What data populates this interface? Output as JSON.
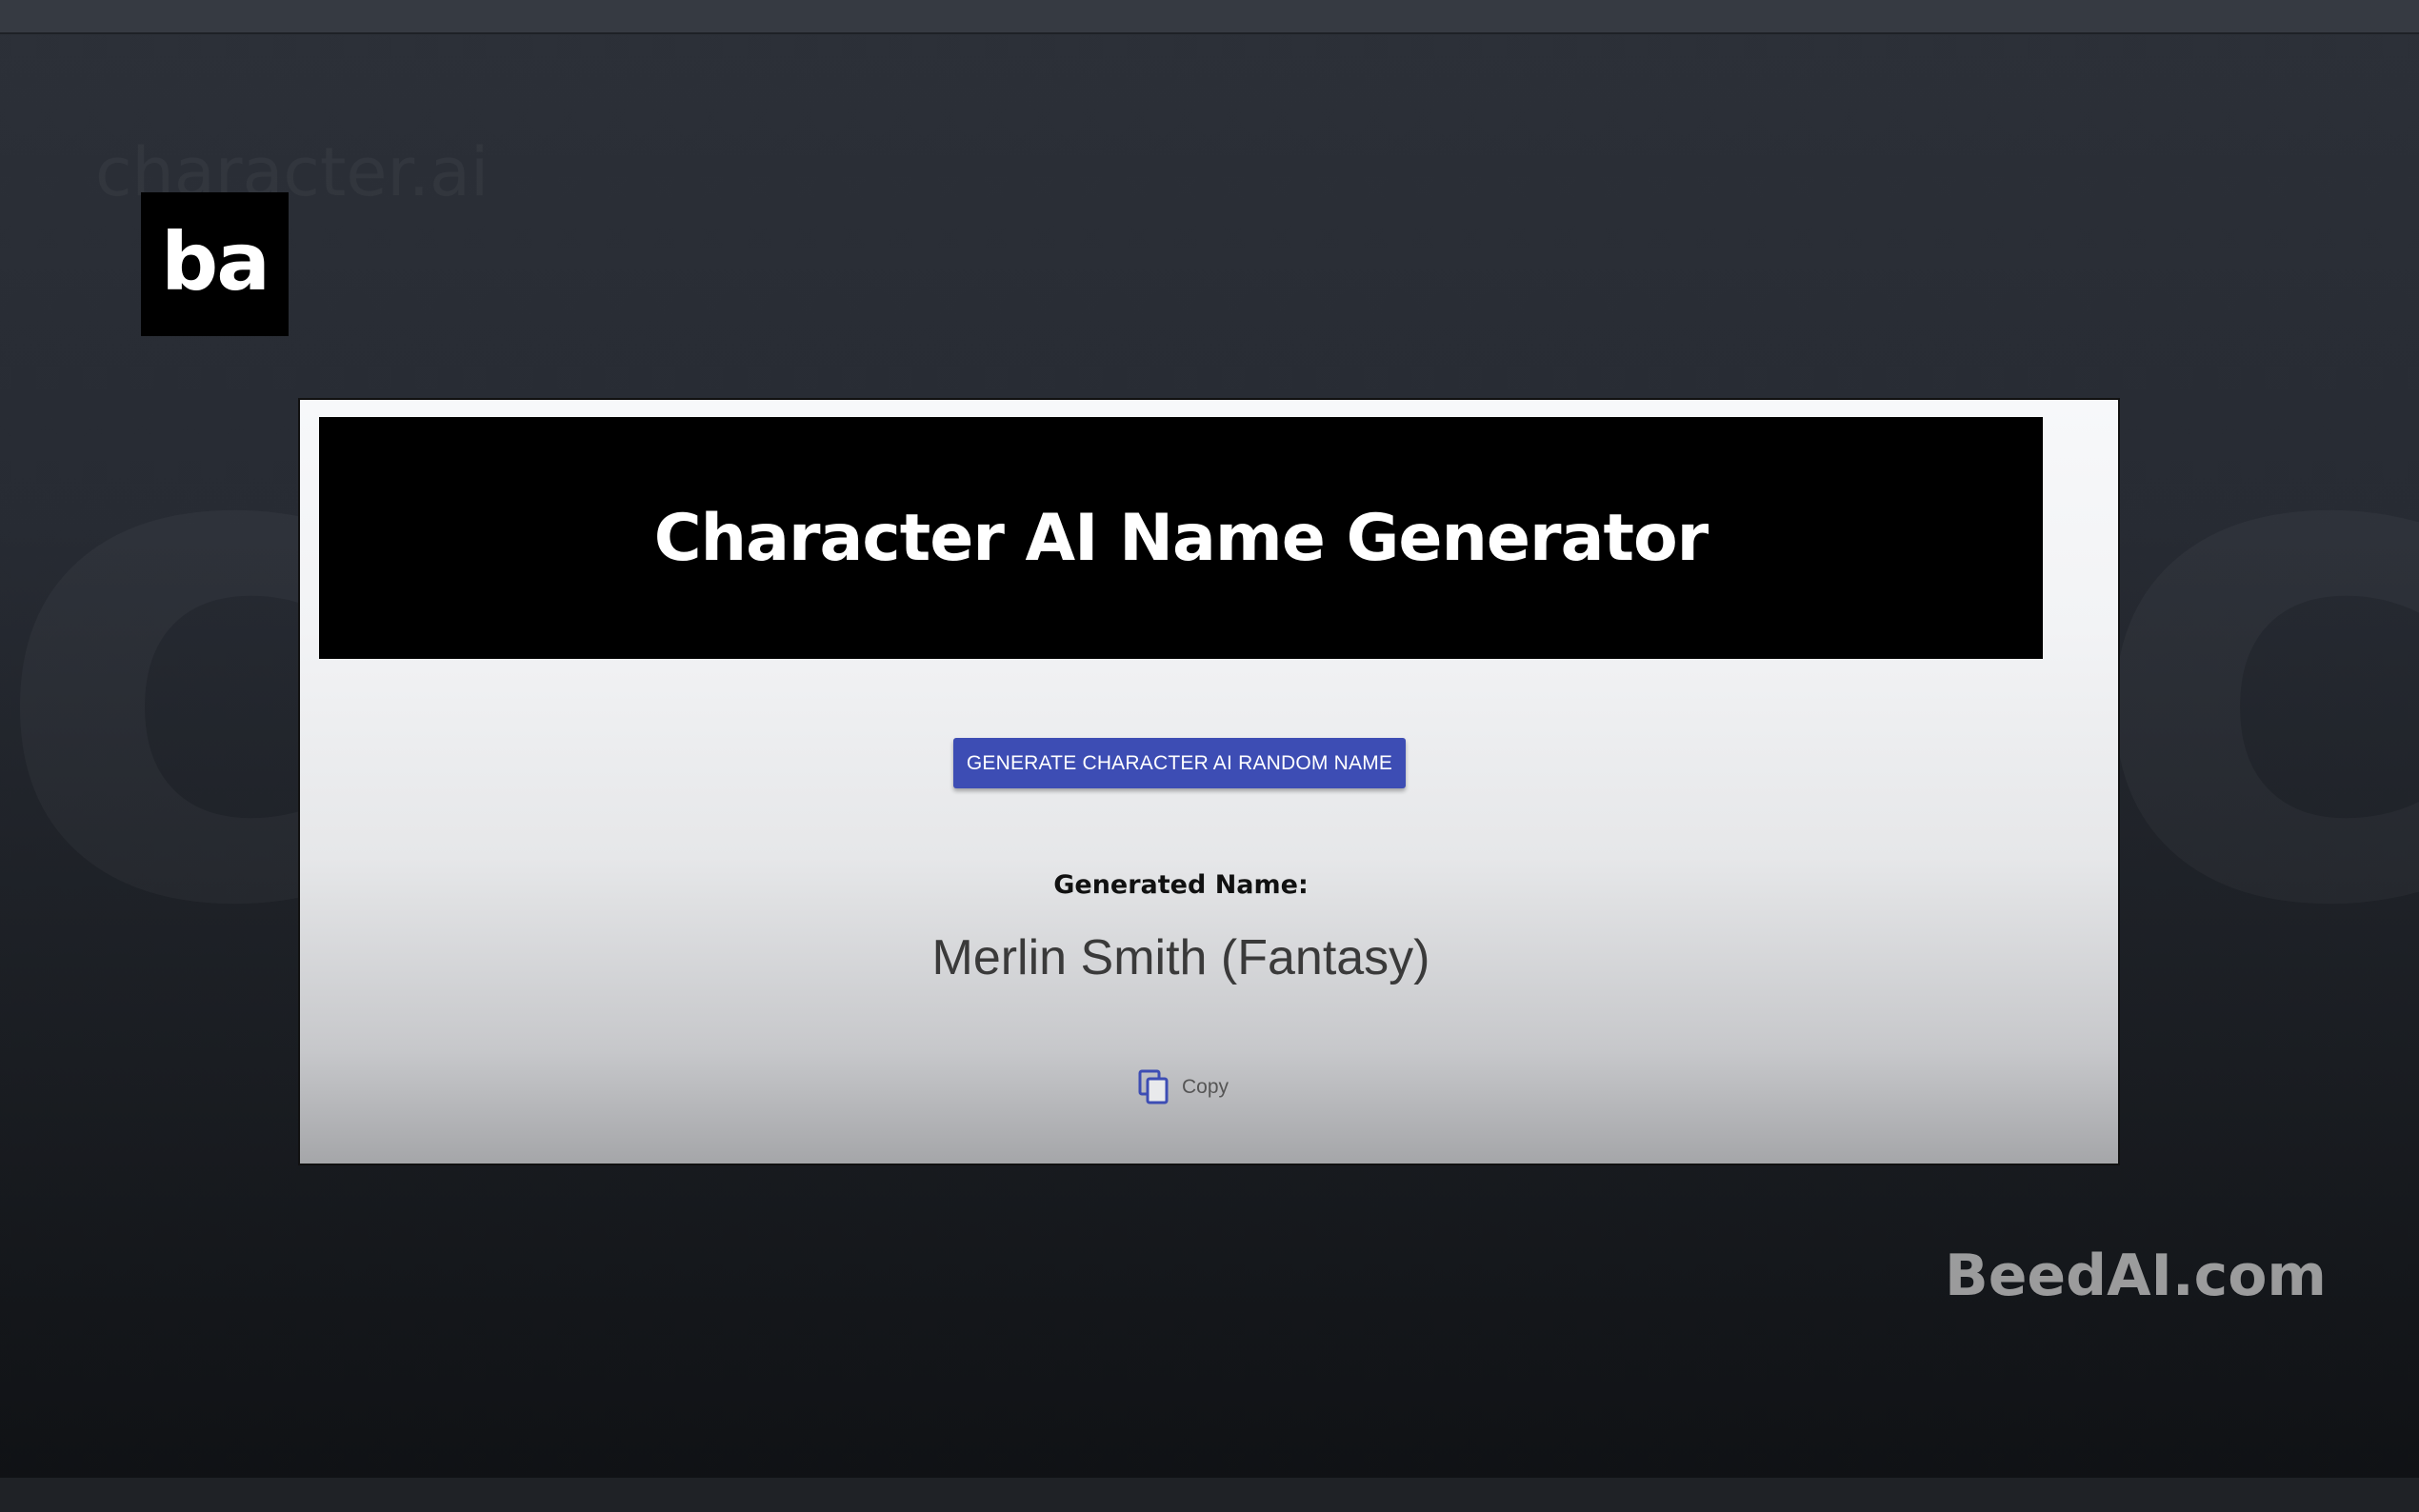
{
  "logo": {
    "text": "ba"
  },
  "card": {
    "title": "Character AI Name Generator",
    "generate_button_label": "GENERATE CHARACTER AI RANDOM NAME",
    "generated_label": "Generated Name:",
    "generated_name": "Merlin Smith (Fantasy)",
    "copy_label": "Copy",
    "copy_icon": "copy-icon",
    "accent_color": "#3d4db4"
  },
  "watermark": {
    "text": "BeedAI.com"
  }
}
